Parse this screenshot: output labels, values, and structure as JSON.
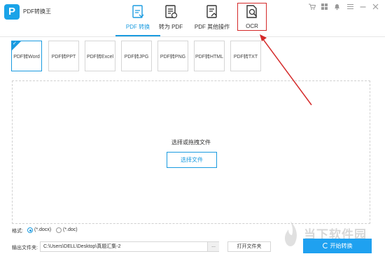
{
  "app": {
    "title": "PDF转换王"
  },
  "nav": {
    "tabs": [
      {
        "label": "PDF 转换",
        "active": true,
        "icon": "convert-doc-icon"
      },
      {
        "label": "转为 PDF",
        "active": false,
        "icon": "to-pdf-doc-icon"
      },
      {
        "label": "PDF 其他操作",
        "active": false,
        "icon": "pdf-tools-icon"
      },
      {
        "label": "OCR",
        "active": false,
        "icon": "ocr-search-icon"
      }
    ]
  },
  "window_controls": [
    "cart-icon",
    "grid-icon",
    "bell-icon",
    "menu-icon",
    "minimize-icon",
    "close-icon"
  ],
  "subtabs": [
    {
      "label": "PDF转Word",
      "active": true
    },
    {
      "label": "PDF转PPT",
      "active": false
    },
    {
      "label": "PDF转Excel",
      "active": false
    },
    {
      "label": "PDF转JPG",
      "active": false
    },
    {
      "label": "PDF转PNG",
      "active": false
    },
    {
      "label": "PDF转HTML",
      "active": false
    },
    {
      "label": "PDF转TXT",
      "active": false
    }
  ],
  "dropzone": {
    "text": "选择或拖拽文件",
    "button_label": "选择文件"
  },
  "format": {
    "label": "格式:",
    "options": [
      {
        "label": "(*.docx)",
        "checked": true
      },
      {
        "label": "(*.doc)",
        "checked": false
      }
    ]
  },
  "output": {
    "label": "输出文件夹:",
    "path": "C:\\Users\\DELL\\Desktop\\真题汇集-2",
    "browse_label": "...",
    "open_folder_label": "打开文件夹"
  },
  "start_button": {
    "label": "开始转换"
  },
  "watermark": {
    "text": "当下软件园"
  },
  "colors": {
    "accent": "#1a9be0",
    "highlight": "#d42a2a",
    "start": "#1fa1f0"
  }
}
